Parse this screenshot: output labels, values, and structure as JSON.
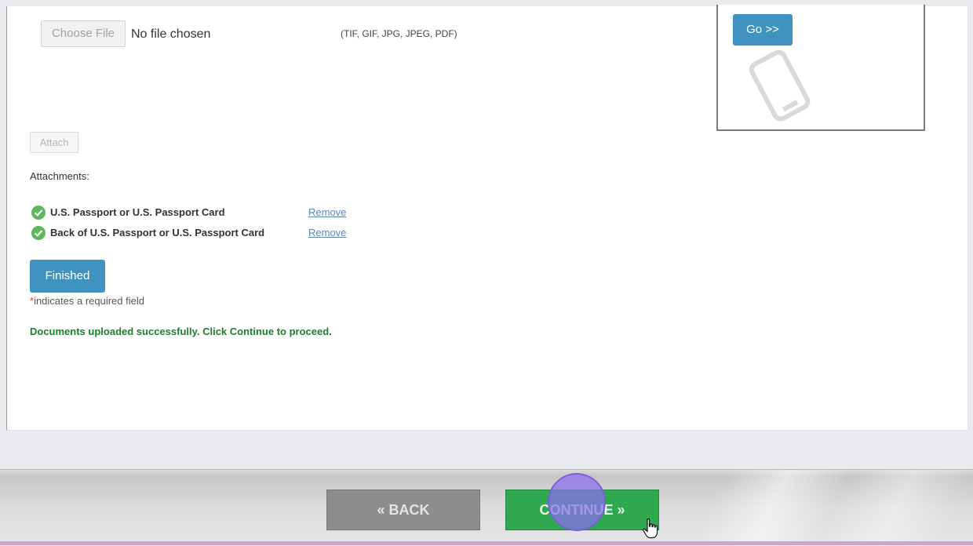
{
  "upload": {
    "choose_file_label": "Choose File",
    "file_status": "No file chosen",
    "formats": "(TIF, GIF, JPG, JPEG, PDF)"
  },
  "mobile": {
    "go_label": "Go >>",
    "icon": "phone-icon"
  },
  "attach_label": "Attach",
  "attachments": {
    "label": "Attachments:",
    "items": [
      {
        "name": "U.S. Passport or U.S. Passport Card",
        "action": "Remove",
        "icon": "check-circle-icon"
      },
      {
        "name": "Back of U.S. Passport or U.S. Passport Card",
        "action": "Remove",
        "icon": "check-circle-icon"
      }
    ]
  },
  "finished_label": "Finished",
  "required": {
    "asterisk": "*",
    "text": "indicates a required field"
  },
  "success_message": "Documents uploaded successfully. Click Continue to proceed.",
  "nav": {
    "back_label": "« BACK",
    "continue_label": "CONTINUE »"
  },
  "colors": {
    "primary_button": "#3f93be",
    "continue_button": "#2fa84f",
    "back_button": "#8d8d8d",
    "success_text": "#1f7d2e",
    "check_icon": "#5cb85c",
    "link": "#5a86b6"
  }
}
